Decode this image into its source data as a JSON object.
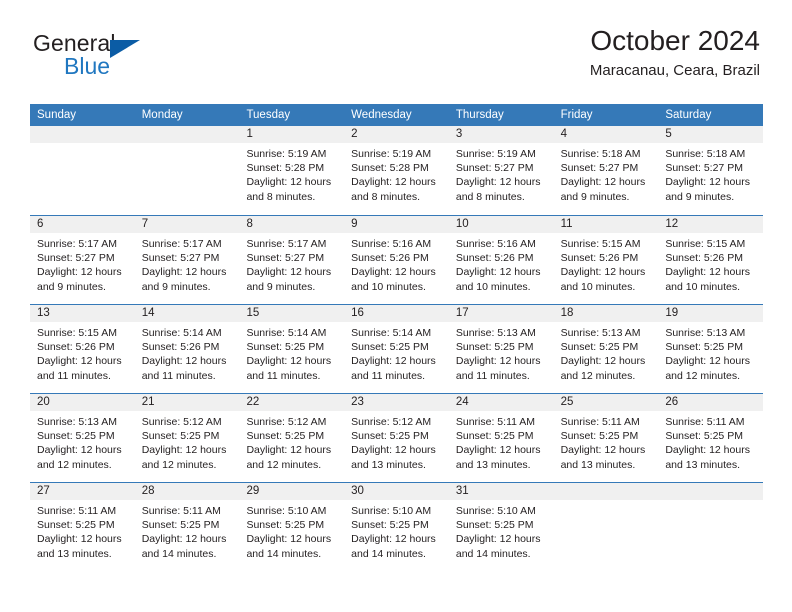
{
  "brand": {
    "name_top": "General",
    "name_bottom": "Blue",
    "accent_color": "#0b5ca5",
    "blue_text_color": "#2077c0"
  },
  "header": {
    "title": "October 2024",
    "subtitle": "Maracanau, Ceara, Brazil"
  },
  "calendar": {
    "header_color": "#3579b8",
    "daynum_band_color": "#f0f0f0",
    "day_names": [
      "Sunday",
      "Monday",
      "Tuesday",
      "Wednesday",
      "Thursday",
      "Friday",
      "Saturday"
    ],
    "weeks": [
      [
        {
          "day": "",
          "sunrise": "",
          "sunset": "",
          "daylight_1": "",
          "daylight_2": ""
        },
        {
          "day": "",
          "sunrise": "",
          "sunset": "",
          "daylight_1": "",
          "daylight_2": ""
        },
        {
          "day": "1",
          "sunrise": "Sunrise: 5:19 AM",
          "sunset": "Sunset: 5:28 PM",
          "daylight_1": "Daylight: 12 hours",
          "daylight_2": "and 8 minutes."
        },
        {
          "day": "2",
          "sunrise": "Sunrise: 5:19 AM",
          "sunset": "Sunset: 5:28 PM",
          "daylight_1": "Daylight: 12 hours",
          "daylight_2": "and 8 minutes."
        },
        {
          "day": "3",
          "sunrise": "Sunrise: 5:19 AM",
          "sunset": "Sunset: 5:27 PM",
          "daylight_1": "Daylight: 12 hours",
          "daylight_2": "and 8 minutes."
        },
        {
          "day": "4",
          "sunrise": "Sunrise: 5:18 AM",
          "sunset": "Sunset: 5:27 PM",
          "daylight_1": "Daylight: 12 hours",
          "daylight_2": "and 9 minutes."
        },
        {
          "day": "5",
          "sunrise": "Sunrise: 5:18 AM",
          "sunset": "Sunset: 5:27 PM",
          "daylight_1": "Daylight: 12 hours",
          "daylight_2": "and 9 minutes."
        }
      ],
      [
        {
          "day": "6",
          "sunrise": "Sunrise: 5:17 AM",
          "sunset": "Sunset: 5:27 PM",
          "daylight_1": "Daylight: 12 hours",
          "daylight_2": "and 9 minutes."
        },
        {
          "day": "7",
          "sunrise": "Sunrise: 5:17 AM",
          "sunset": "Sunset: 5:27 PM",
          "daylight_1": "Daylight: 12 hours",
          "daylight_2": "and 9 minutes."
        },
        {
          "day": "8",
          "sunrise": "Sunrise: 5:17 AM",
          "sunset": "Sunset: 5:27 PM",
          "daylight_1": "Daylight: 12 hours",
          "daylight_2": "and 9 minutes."
        },
        {
          "day": "9",
          "sunrise": "Sunrise: 5:16 AM",
          "sunset": "Sunset: 5:26 PM",
          "daylight_1": "Daylight: 12 hours",
          "daylight_2": "and 10 minutes."
        },
        {
          "day": "10",
          "sunrise": "Sunrise: 5:16 AM",
          "sunset": "Sunset: 5:26 PM",
          "daylight_1": "Daylight: 12 hours",
          "daylight_2": "and 10 minutes."
        },
        {
          "day": "11",
          "sunrise": "Sunrise: 5:15 AM",
          "sunset": "Sunset: 5:26 PM",
          "daylight_1": "Daylight: 12 hours",
          "daylight_2": "and 10 minutes."
        },
        {
          "day": "12",
          "sunrise": "Sunrise: 5:15 AM",
          "sunset": "Sunset: 5:26 PM",
          "daylight_1": "Daylight: 12 hours",
          "daylight_2": "and 10 minutes."
        }
      ],
      [
        {
          "day": "13",
          "sunrise": "Sunrise: 5:15 AM",
          "sunset": "Sunset: 5:26 PM",
          "daylight_1": "Daylight: 12 hours",
          "daylight_2": "and 11 minutes."
        },
        {
          "day": "14",
          "sunrise": "Sunrise: 5:14 AM",
          "sunset": "Sunset: 5:26 PM",
          "daylight_1": "Daylight: 12 hours",
          "daylight_2": "and 11 minutes."
        },
        {
          "day": "15",
          "sunrise": "Sunrise: 5:14 AM",
          "sunset": "Sunset: 5:25 PM",
          "daylight_1": "Daylight: 12 hours",
          "daylight_2": "and 11 minutes."
        },
        {
          "day": "16",
          "sunrise": "Sunrise: 5:14 AM",
          "sunset": "Sunset: 5:25 PM",
          "daylight_1": "Daylight: 12 hours",
          "daylight_2": "and 11 minutes."
        },
        {
          "day": "17",
          "sunrise": "Sunrise: 5:13 AM",
          "sunset": "Sunset: 5:25 PM",
          "daylight_1": "Daylight: 12 hours",
          "daylight_2": "and 11 minutes."
        },
        {
          "day": "18",
          "sunrise": "Sunrise: 5:13 AM",
          "sunset": "Sunset: 5:25 PM",
          "daylight_1": "Daylight: 12 hours",
          "daylight_2": "and 12 minutes."
        },
        {
          "day": "19",
          "sunrise": "Sunrise: 5:13 AM",
          "sunset": "Sunset: 5:25 PM",
          "daylight_1": "Daylight: 12 hours",
          "daylight_2": "and 12 minutes."
        }
      ],
      [
        {
          "day": "20",
          "sunrise": "Sunrise: 5:13 AM",
          "sunset": "Sunset: 5:25 PM",
          "daylight_1": "Daylight: 12 hours",
          "daylight_2": "and 12 minutes."
        },
        {
          "day": "21",
          "sunrise": "Sunrise: 5:12 AM",
          "sunset": "Sunset: 5:25 PM",
          "daylight_1": "Daylight: 12 hours",
          "daylight_2": "and 12 minutes."
        },
        {
          "day": "22",
          "sunrise": "Sunrise: 5:12 AM",
          "sunset": "Sunset: 5:25 PM",
          "daylight_1": "Daylight: 12 hours",
          "daylight_2": "and 12 minutes."
        },
        {
          "day": "23",
          "sunrise": "Sunrise: 5:12 AM",
          "sunset": "Sunset: 5:25 PM",
          "daylight_1": "Daylight: 12 hours",
          "daylight_2": "and 13 minutes."
        },
        {
          "day": "24",
          "sunrise": "Sunrise: 5:11 AM",
          "sunset": "Sunset: 5:25 PM",
          "daylight_1": "Daylight: 12 hours",
          "daylight_2": "and 13 minutes."
        },
        {
          "day": "25",
          "sunrise": "Sunrise: 5:11 AM",
          "sunset": "Sunset: 5:25 PM",
          "daylight_1": "Daylight: 12 hours",
          "daylight_2": "and 13 minutes."
        },
        {
          "day": "26",
          "sunrise": "Sunrise: 5:11 AM",
          "sunset": "Sunset: 5:25 PM",
          "daylight_1": "Daylight: 12 hours",
          "daylight_2": "and 13 minutes."
        }
      ],
      [
        {
          "day": "27",
          "sunrise": "Sunrise: 5:11 AM",
          "sunset": "Sunset: 5:25 PM",
          "daylight_1": "Daylight: 12 hours",
          "daylight_2": "and 13 minutes."
        },
        {
          "day": "28",
          "sunrise": "Sunrise: 5:11 AM",
          "sunset": "Sunset: 5:25 PM",
          "daylight_1": "Daylight: 12 hours",
          "daylight_2": "and 14 minutes."
        },
        {
          "day": "29",
          "sunrise": "Sunrise: 5:10 AM",
          "sunset": "Sunset: 5:25 PM",
          "daylight_1": "Daylight: 12 hours",
          "daylight_2": "and 14 minutes."
        },
        {
          "day": "30",
          "sunrise": "Sunrise: 5:10 AM",
          "sunset": "Sunset: 5:25 PM",
          "daylight_1": "Daylight: 12 hours",
          "daylight_2": "and 14 minutes."
        },
        {
          "day": "31",
          "sunrise": "Sunrise: 5:10 AM",
          "sunset": "Sunset: 5:25 PM",
          "daylight_1": "Daylight: 12 hours",
          "daylight_2": "and 14 minutes."
        },
        {
          "day": "",
          "sunrise": "",
          "sunset": "",
          "daylight_1": "",
          "daylight_2": ""
        },
        {
          "day": "",
          "sunrise": "",
          "sunset": "",
          "daylight_1": "",
          "daylight_2": ""
        }
      ]
    ]
  }
}
